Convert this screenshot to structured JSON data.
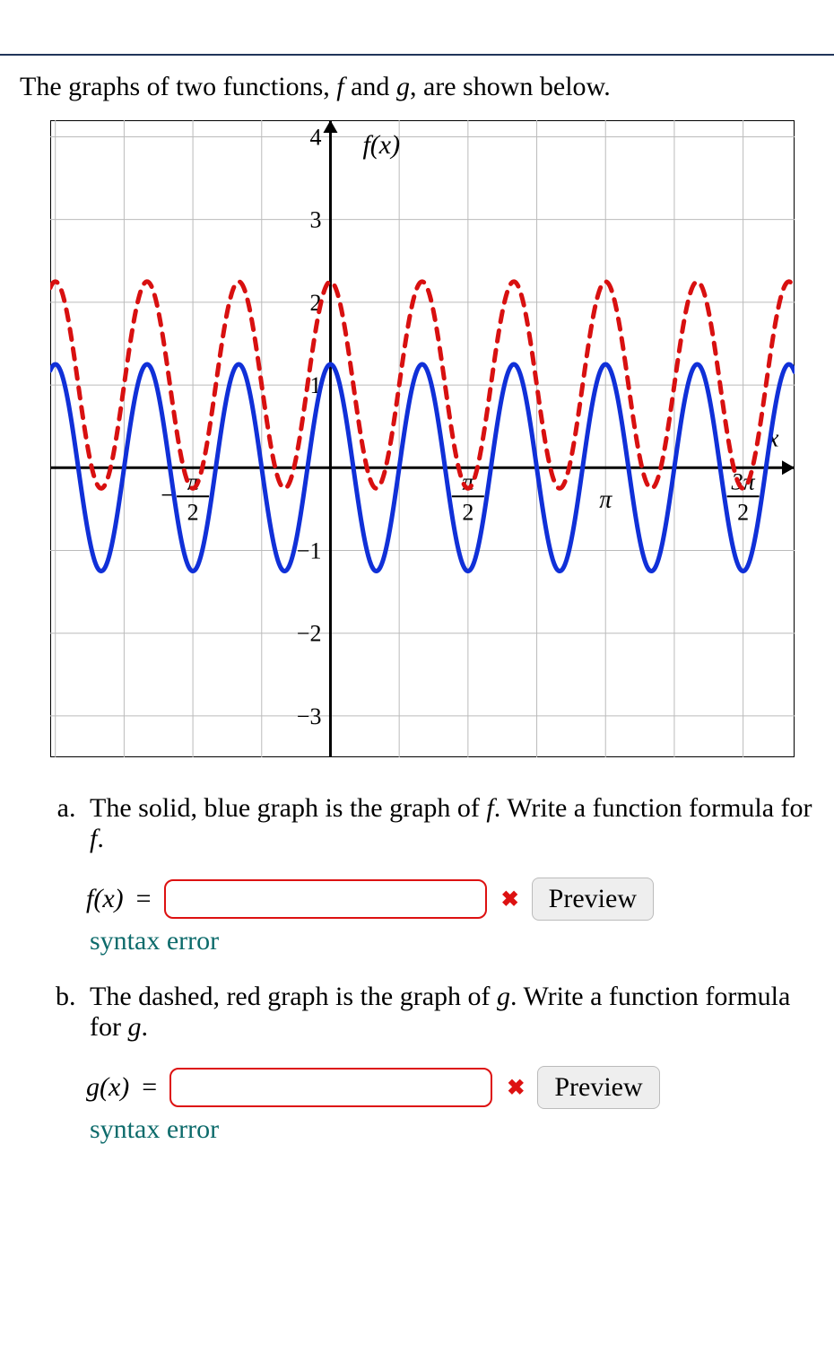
{
  "prompt": "The graphs of two functions, f and g, are shown below.",
  "parts": {
    "a": {
      "text": "The solid, blue graph is the graph of f. Write a function formula for f.",
      "lhs": "f(x)",
      "value": "",
      "error": "syntax error",
      "preview": "Preview"
    },
    "b": {
      "text": "The dashed, red graph is the graph of g. Write a function formula for g.",
      "lhs": "g(x)",
      "value": "",
      "error": "syntax error",
      "preview": "Preview"
    }
  },
  "chart_data": {
    "type": "line",
    "title": "f(x)",
    "xlabel": "x",
    "ylabel": "",
    "xlim": [
      -3.2,
      5.3
    ],
    "ylim": [
      -3.5,
      4.2
    ],
    "x_ticks": [
      -1.5708,
      1.5708,
      3.1416,
      4.7124
    ],
    "x_tick_labels": [
      "-π/2",
      "π/2",
      "π",
      "3π/2"
    ],
    "y_ticks": [
      -3,
      -2,
      -1,
      1,
      2,
      3,
      4
    ],
    "series": [
      {
        "name": "f",
        "style": "solid",
        "color": "#1030d8",
        "formula": "1.25*cos(6*x)",
        "amplitude": 1.25,
        "midline": 0,
        "angular_frequency": 6
      },
      {
        "name": "g",
        "style": "dashed",
        "color": "#d81010",
        "formula": "1.25*cos(6*x) + 1",
        "amplitude": 1.25,
        "midline": 1,
        "angular_frequency": 6
      }
    ]
  }
}
